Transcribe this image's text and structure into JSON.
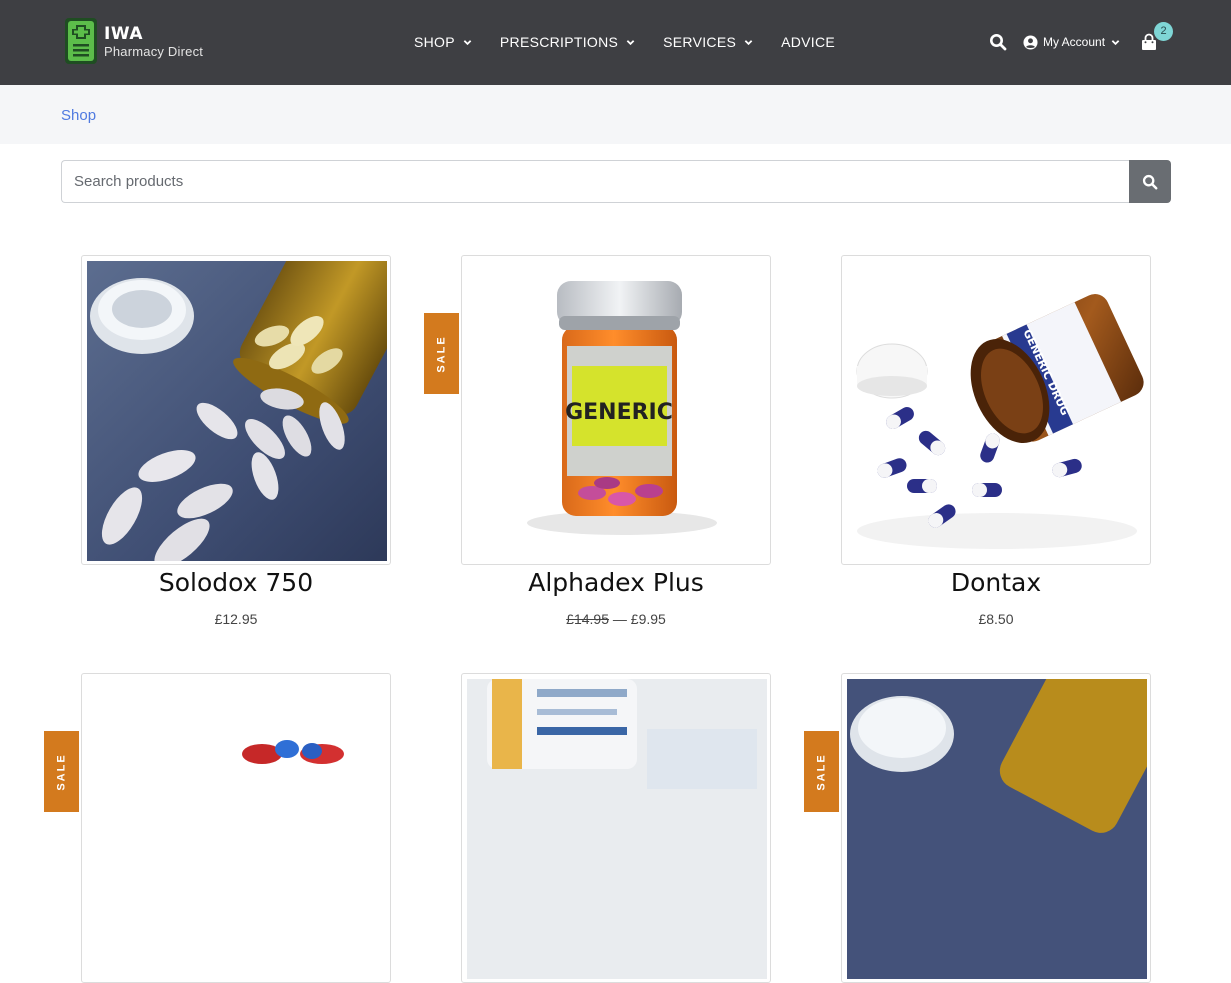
{
  "brand": {
    "name": "IWA",
    "tagline": "Pharmacy Direct"
  },
  "nav": [
    {
      "label": "SHOP",
      "has_dropdown": true
    },
    {
      "label": "PRESCRIPTIONS",
      "has_dropdown": true
    },
    {
      "label": "SERVICES",
      "has_dropdown": true
    },
    {
      "label": "ADVICE",
      "has_dropdown": false
    }
  ],
  "header_right": {
    "account_label": "My Account",
    "cart_count": "2",
    "search_icon": "search-icon",
    "account_icon": "user-circle-icon",
    "cart_icon": "shopping-bag-icon"
  },
  "breadcrumb": {
    "current": "Shop"
  },
  "search": {
    "placeholder": "Search products",
    "value": ""
  },
  "sale_label": "SALE",
  "colors": {
    "header_bg": "#3e3f43",
    "accent_sale": "#d37a1e",
    "link": "#4f7ae0",
    "badge": "#7fd6d6",
    "brand_green": "#5cbd4a"
  },
  "products": [
    {
      "name": "Solodox 750",
      "price": "£12.95",
      "on_sale": false
    },
    {
      "name": "Alphadex Plus",
      "regular_price": "£14.95",
      "price_separator": "—",
      "price": "£9.95",
      "on_sale": true,
      "bottle_label": "GENERIC"
    },
    {
      "name": "Dontax",
      "price": "£8.50",
      "on_sale": false,
      "bottle_label": "GENERIC DRUG"
    }
  ],
  "next_row": [
    {
      "on_sale": true
    },
    {
      "on_sale": false
    },
    {
      "on_sale": true
    }
  ]
}
